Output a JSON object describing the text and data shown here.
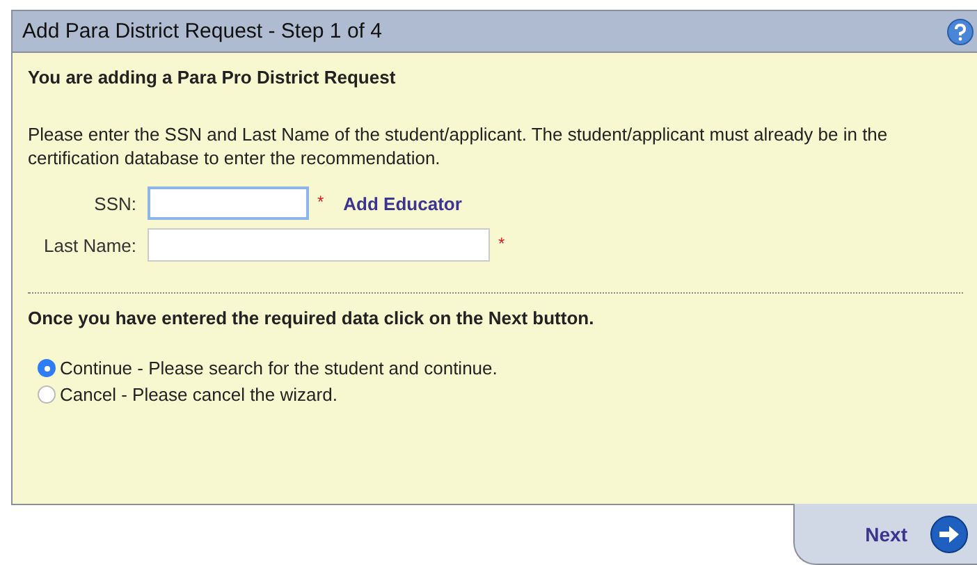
{
  "window": {
    "title": "Add Para District Request - Step 1 of 4"
  },
  "heading": "You are adding a Para Pro District Request",
  "instructions": "Please enter the SSN and Last Name of the student/applicant. The student/applicant must already be in the certification database to enter the recommendation.",
  "fields": [
    {
      "label": "SSN:",
      "focused": true,
      "required": true,
      "link": "Add Educator",
      "kind": "short"
    },
    {
      "label": "Last Name:",
      "focused": false,
      "required": true,
      "kind": "long"
    }
  ],
  "required_mark": "*",
  "next_hint": "Once you have entered the required data click on the Next button.",
  "options": [
    {
      "label": "Continue - Please search for the student and continue.",
      "selected": true
    },
    {
      "label": "Cancel - Please cancel the wizard.",
      "selected": false
    }
  ],
  "next_button": "Next"
}
